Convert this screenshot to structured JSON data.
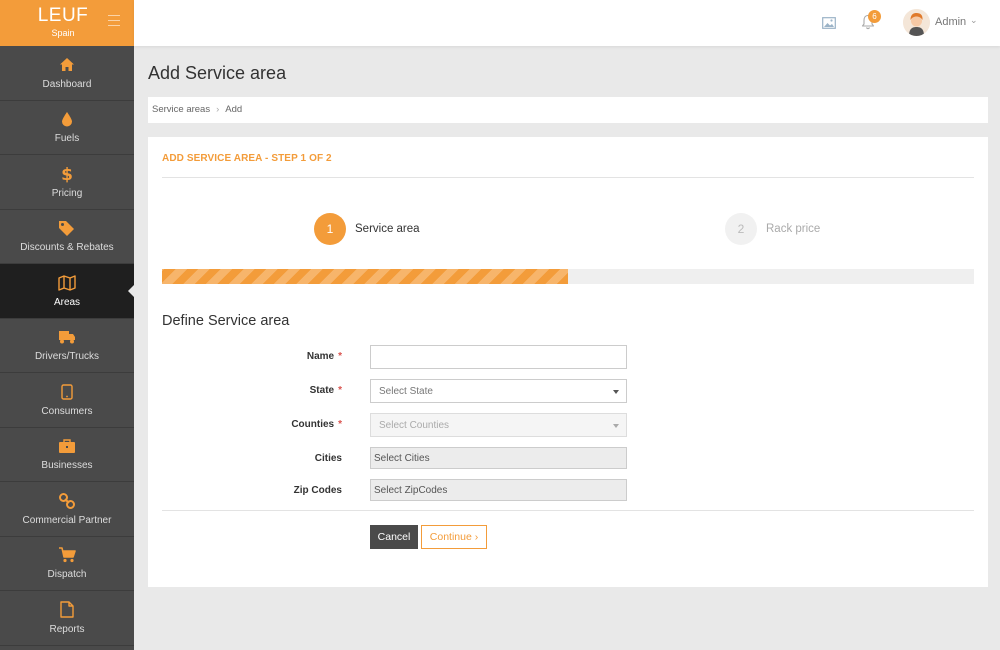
{
  "brand": {
    "name": "LEUF",
    "country": "Spain"
  },
  "sidebar": {
    "items": [
      {
        "label": "Dashboard",
        "icon": "home-icon"
      },
      {
        "label": "Fuels",
        "icon": "drop-icon"
      },
      {
        "label": "Pricing",
        "icon": "dollar-icon"
      },
      {
        "label": "Discounts & Rebates",
        "icon": "tags-icon"
      },
      {
        "label": "Areas",
        "icon": "map-icon",
        "active": true
      },
      {
        "label": "Drivers/Trucks",
        "icon": "truck-icon"
      },
      {
        "label": "Consumers",
        "icon": "tablet-icon"
      },
      {
        "label": "Businesses",
        "icon": "briefcase-icon"
      },
      {
        "label": "Commercial Partner",
        "icon": "link-icon"
      },
      {
        "label": "Dispatch",
        "icon": "cart-icon"
      },
      {
        "label": "Reports",
        "icon": "file-icon"
      }
    ]
  },
  "topbar": {
    "notifications": "6",
    "user": "Admin"
  },
  "page": {
    "title": "Add Service area"
  },
  "breadcrumb": {
    "parent": "Service areas",
    "current": "Add"
  },
  "wizard": {
    "heading": "ADD SERVICE AREA - STEP 1 OF 2",
    "steps": [
      {
        "num": "1",
        "label": "Service area"
      },
      {
        "num": "2",
        "label": "Rack price"
      }
    ],
    "progress": 0.5
  },
  "form": {
    "section_title": "Define Service area",
    "name_label": "Name",
    "name_value": "",
    "state_label": "State",
    "state_value": "Select State",
    "counties_label": "Counties",
    "counties_value": "Select Counties",
    "cities_label": "Cities",
    "cities_value": "Select Cities",
    "zipcodes_label": "Zip Codes",
    "zipcodes_value": "Select ZipCodes",
    "required_mark": "*",
    "cancel_label": "Cancel",
    "continue_label": "Continue ›"
  },
  "colors": {
    "accent": "#f39c3a",
    "sidebar": "#4a4a4a",
    "sidebar_active": "#1f1f1f"
  }
}
